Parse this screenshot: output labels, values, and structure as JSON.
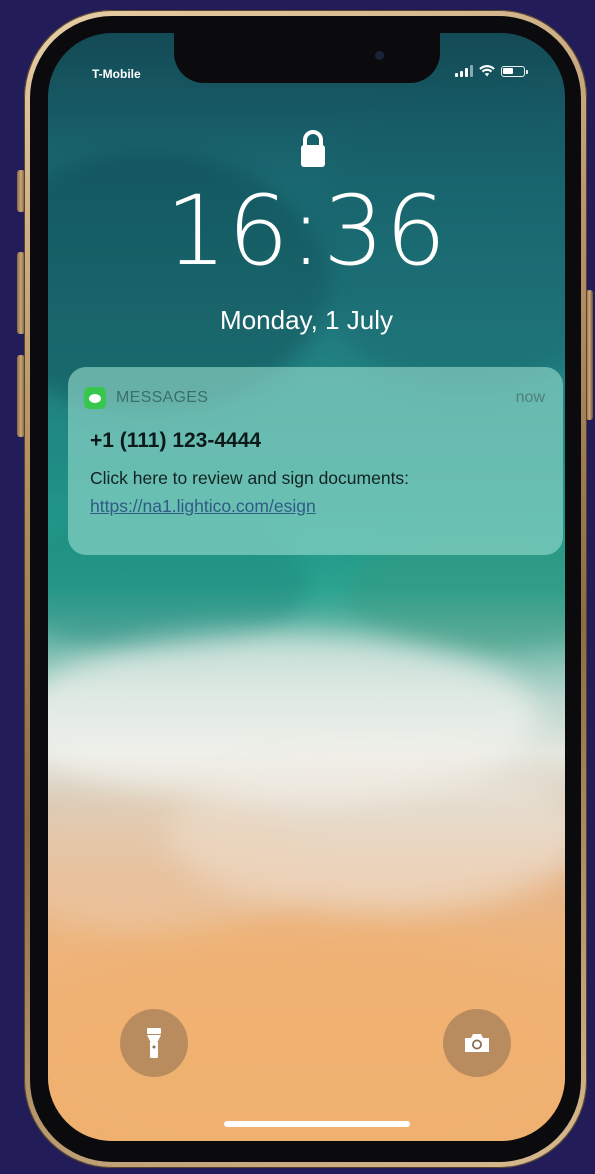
{
  "status_bar": {
    "carrier": "T-Mobile",
    "signal_icon": "signal-bars-icon",
    "wifi_icon": "wifi-icon",
    "battery_icon": "battery-icon",
    "battery_level": 0.55
  },
  "lock_screen": {
    "lock_icon": "lock-icon",
    "time": "16:36",
    "date": "Monday, 1 July"
  },
  "notification": {
    "app_icon": "messages-icon",
    "app_name": "MESSAGES",
    "time": "now",
    "sender": "+1 (111) 123-4444",
    "body": "Click here to review and sign documents:",
    "link": "https://na1.lightico.com/esign"
  },
  "quick_actions": {
    "flashlight_icon": "flashlight-icon",
    "camera_icon": "camera-icon"
  },
  "colors": {
    "background": "#221c58",
    "frame_gold": "#c9a77c",
    "messages_green": "#37c74f",
    "link_blue": "#2f5b86"
  }
}
